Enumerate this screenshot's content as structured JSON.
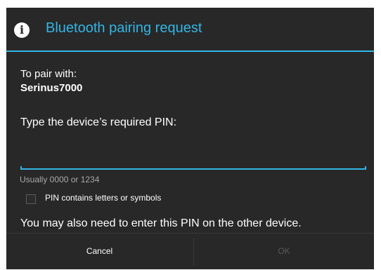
{
  "dialog": {
    "title": "Bluetooth pairing request",
    "title_icon": "info-icon",
    "title_icon_glyph": "i",
    "accent_color": "#33b5e5",
    "background_color": "#282828"
  },
  "content": {
    "pair_with_label": "To pair with:",
    "device_name": "Serinus7000",
    "type_pin_prompt": "Type the device’s required PIN:",
    "pin_input_value": "",
    "hint": "Usually 0000 or 1234",
    "checkbox_label": "PIN contains letters or symbols",
    "checkbox_checked": false,
    "also_enter_note": "You may also need to enter this PIN on the other device."
  },
  "buttons": {
    "cancel_label": "Cancel",
    "ok_label": "OK",
    "ok_enabled": false
  }
}
